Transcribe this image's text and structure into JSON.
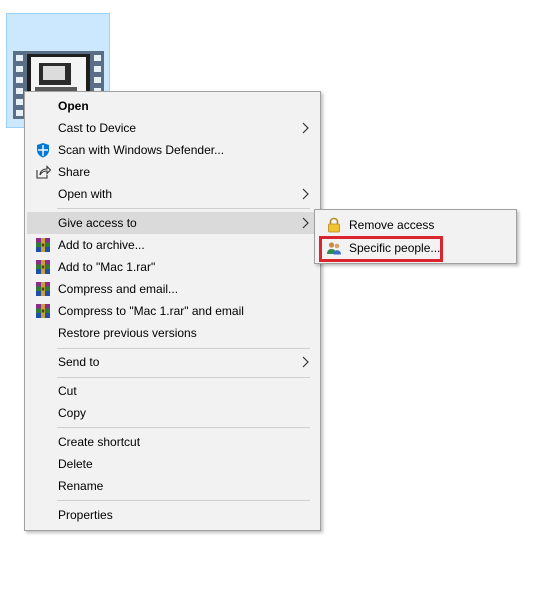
{
  "context_menu": {
    "items": [
      {
        "label": "Open",
        "bold": true
      },
      {
        "label": "Cast to Device",
        "has_submenu": true
      },
      {
        "label": "Scan with Windows Defender...",
        "icon": "windows-defender-icon"
      },
      {
        "label": "Share",
        "icon": "share-icon"
      },
      {
        "label": "Open with",
        "has_submenu": true
      },
      {
        "label": "Give access to",
        "has_submenu": true,
        "highlighted": true
      },
      {
        "label": "Add to archive...",
        "icon": "winrar-icon"
      },
      {
        "label": "Add to \"Mac 1.rar\"",
        "icon": "winrar-icon"
      },
      {
        "label": "Compress and email...",
        "icon": "winrar-icon"
      },
      {
        "label": "Compress to \"Mac 1.rar\" and email",
        "icon": "winrar-icon"
      },
      {
        "label": "Restore previous versions"
      },
      {
        "label": "Send to",
        "has_submenu": true
      },
      {
        "label": "Cut"
      },
      {
        "label": "Copy"
      },
      {
        "label": "Create shortcut"
      },
      {
        "label": "Delete"
      },
      {
        "label": "Rename"
      },
      {
        "label": "Properties"
      }
    ]
  },
  "give_access_submenu": {
    "items": [
      {
        "label": "Remove access",
        "icon": "lock-icon"
      },
      {
        "label": "Specific people...",
        "icon": "people-icon",
        "annotated": true
      }
    ]
  },
  "colors": {
    "menu_background": "#f2f2f2",
    "highlight": "#dadada",
    "selection_tile": "#cce8ff",
    "annotation_red": "#d9262e",
    "defender_blue": "#0078d7"
  }
}
